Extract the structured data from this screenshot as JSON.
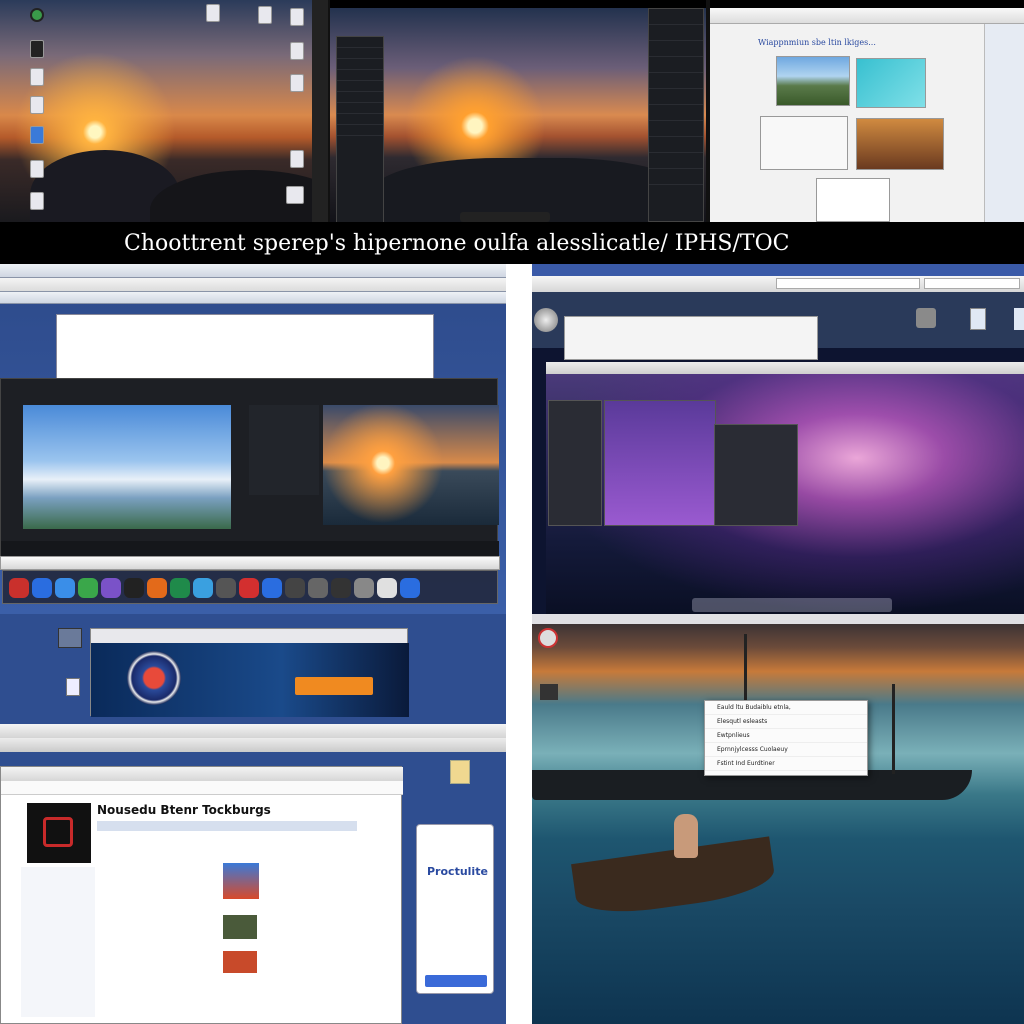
{
  "headline": "Choottrent sperep's hipernone oulfa alesslicatle/ IPHS/TOC",
  "top_left": {
    "desktop_icons": [
      "",
      "",
      "",
      "",
      "",
      ""
    ]
  },
  "top_mid": {
    "menu_items": [
      "",
      "",
      "",
      "",
      "",
      "",
      "",
      "",
      ""
    ],
    "right_menu_items": [
      "",
      "",
      "",
      "",
      "",
      "",
      "",
      "",
      "",
      "",
      ""
    ]
  },
  "top_right": {
    "heading": "Wiappnmiun sbe ltin lkiges..."
  },
  "mid_left": {
    "dock_colors": [
      "#c9302c",
      "#2a6de0",
      "#3a8ee8",
      "#3aa74a",
      "#7a52c8",
      "#222",
      "#e36a1a",
      "#1f8a4a",
      "#3aa0e0",
      "#555",
      "#d32f2f",
      "#2a6de0",
      "#444",
      "#666",
      "#333",
      "#888",
      "#e0e0e0",
      "#2a6de0"
    ]
  },
  "mid_right": {
    "url": ""
  },
  "bottom_left": {
    "promo_button": "",
    "page_title": "Nousedu Btenr Tockburgs",
    "sidebar_label": "Proctulite"
  },
  "bottom_right": {
    "context_menu": [
      "Eauld ltu Budaiblu etnla,",
      "Elesqutl esleasts",
      "Ewtpnlieus",
      "Eprnnjylcesss Cuolaeuy",
      "Fstint Ind Eurdtiner"
    ]
  }
}
